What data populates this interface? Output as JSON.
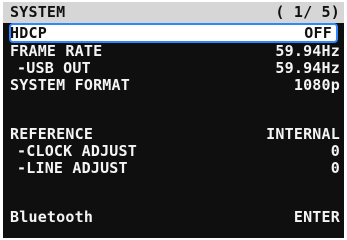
{
  "header": {
    "title": "SYSTEM",
    "page_indicator": "( 1/ 5)"
  },
  "menu": {
    "items": [
      {
        "label": "HDCP",
        "value": "OFF"
      },
      {
        "label": "FRAME RATE",
        "value": "59.94Hz"
      },
      {
        "label": "-USB OUT",
        "value": "59.94Hz"
      },
      {
        "label": "SYSTEM FORMAT",
        "value": "1080p"
      },
      {
        "label": "REFERENCE",
        "value": "INTERNAL"
      },
      {
        "label": "-CLOCK ADJUST",
        "value": "0"
      },
      {
        "label": "-LINE ADJUST",
        "value": "0"
      },
      {
        "label": "Bluetooth",
        "value": "ENTER"
      }
    ],
    "selected_index": 0
  },
  "colors": {
    "background": "#0f0f0f",
    "header_background": "#d6d6d6",
    "selection_fill": "#ffffff",
    "selection_border": "#2f86ff",
    "text": "#f4f4f4"
  }
}
